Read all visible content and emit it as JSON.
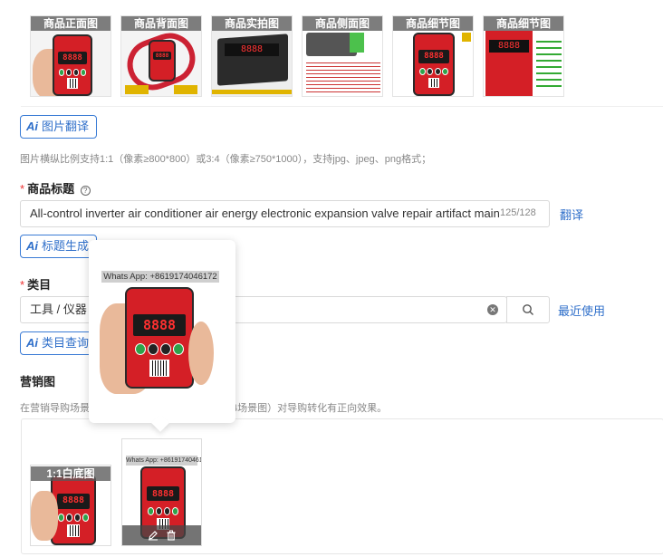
{
  "product_images": {
    "items": [
      {
        "caption": "商品正面图"
      },
      {
        "caption": "商品背面图"
      },
      {
        "caption": "商品实拍图"
      },
      {
        "caption": "商品侧面图"
      },
      {
        "caption": "商品细节图"
      },
      {
        "caption": "商品细节图"
      }
    ],
    "ai_translate_label": "图片翻译",
    "hint": "图片横纵比例支持1:1（像素≥800*800）或3:4（像素≥750*1000），支持jpg、jpeg、png格式；"
  },
  "title_section": {
    "label": "商品标题",
    "value": "All-control inverter air conditioner air energy electronic expansion valve repair artifact maint",
    "counter": "125/128",
    "translate_link": "翻译",
    "ai_generate_label": "标题生成"
  },
  "category_section": {
    "label": "类目",
    "value": "工具 / 仪器",
    "recent_link": "最近使用",
    "ai_query_label": "类目查询"
  },
  "marketing": {
    "label": "营销图",
    "hint_left": "在营销导购场景",
    "hint_right": "4场景图）对导购转化有正向效果。",
    "white_bg_caption": "1:1白底图"
  },
  "popover": {
    "watermark": "Whats App: +8619174046172"
  },
  "thumb_watermark": "Whats App: +8619174046172",
  "device": {
    "display": "8888"
  },
  "colors": {
    "accent": "#2f6fca",
    "device_red": "#d41f26"
  }
}
